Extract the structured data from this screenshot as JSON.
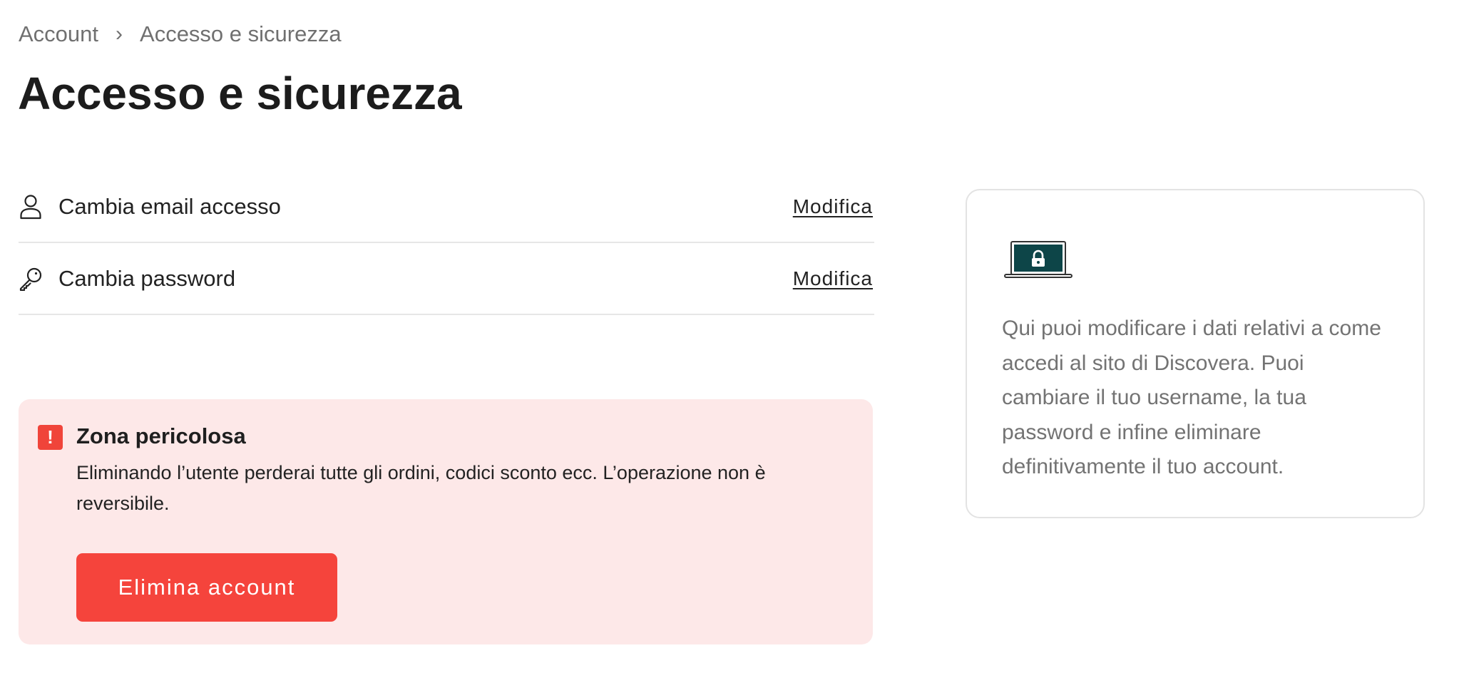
{
  "breadcrumb": {
    "root": "Account",
    "separator": "›",
    "current": "Accesso e sicurezza"
  },
  "page": {
    "title": "Accesso e sicurezza"
  },
  "settings": {
    "items": [
      {
        "icon": "user-icon",
        "label": "Cambia email accesso",
        "action": "Modifica"
      },
      {
        "icon": "key-icon",
        "label": "Cambia password",
        "action": "Modifica"
      }
    ]
  },
  "danger_zone": {
    "icon": "alert-icon",
    "icon_glyph": "!",
    "title": "Zona pericolosa",
    "text": "Eliminando l’utente perderai tutte gli ordini, codici sconto ecc. L’operazione non è reversibile.",
    "button_label": "Elimina account",
    "colors": {
      "background": "#fde8e8",
      "accent": "#f5443c"
    }
  },
  "info_card": {
    "illustration": "laptop-lock-icon",
    "text": "Qui puoi modificare i dati relativi a come accedi al sito di Discovera. Puoi cambiare il tuo username, la tua password e infine eliminare definitivamente il tuo account.",
    "colors": {
      "screen": "#0d4548"
    }
  }
}
